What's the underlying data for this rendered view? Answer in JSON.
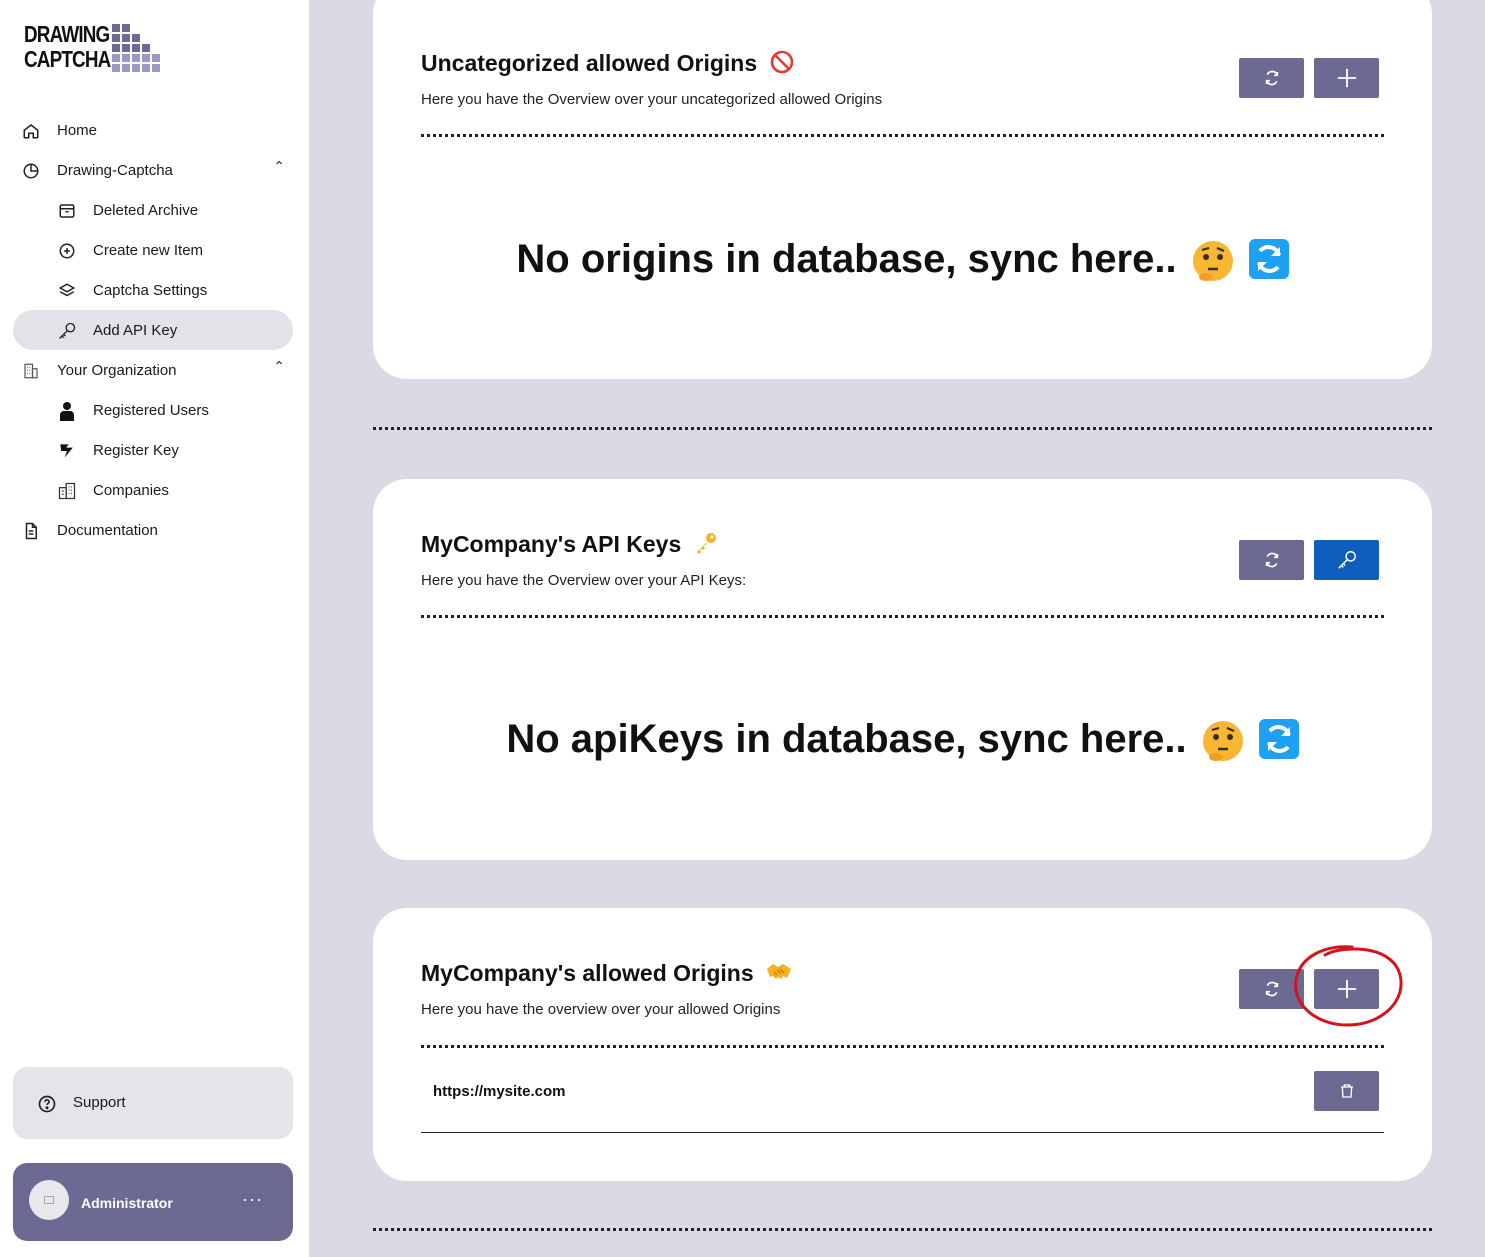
{
  "logo": {
    "line1": "DRAWING",
    "line2": "CAPTCHA"
  },
  "sidebar": {
    "items": [
      {
        "label": "Home",
        "icon": "home-icon"
      },
      {
        "label": "Drawing-Captcha",
        "icon": "pie-chart-icon"
      },
      {
        "label": "Deleted Archive",
        "icon": "archive-icon"
      },
      {
        "label": "Create new Item",
        "icon": "plus-circle-icon"
      },
      {
        "label": "Captcha Settings",
        "icon": "layers-icon"
      },
      {
        "label": "Add API Key",
        "icon": "key-icon"
      },
      {
        "label": "Your Organization",
        "icon": "building-icon"
      },
      {
        "label": "Registered Users",
        "icon": "user-icon"
      },
      {
        "label": "Register Key",
        "icon": "register-key-icon"
      },
      {
        "label": "Companies",
        "icon": "companies-icon"
      },
      {
        "label": "Documentation",
        "icon": "document-icon"
      }
    ],
    "support_label": "Support",
    "user_name": "Administrator",
    "user_more": "···"
  },
  "cards": {
    "uncategorized": {
      "title": "Uncategorized allowed Origins",
      "subtitle": "Here you have the Overview over your uncategorized allowed Origins",
      "empty_message": "No origins in database, sync here..",
      "title_icon": "no-entry-icon"
    },
    "api_keys": {
      "title": "MyCompany's API Keys",
      "subtitle": "Here you have the Overview over your API Keys:",
      "empty_message": "No apiKeys in database, sync here..",
      "title_icon": "key-emoji-icon"
    },
    "allowed_origins": {
      "title": "MyCompany's allowed Origins",
      "subtitle": "Here you have the overview over your allowed Origins",
      "title_icon": "handshake-icon",
      "origins": [
        "https://mysite.com"
      ]
    }
  },
  "colors": {
    "accent": "#6c6a93",
    "blue_button": "#0f5dbd",
    "background": "#d9dae3",
    "annotation_red": "#d4141c"
  }
}
